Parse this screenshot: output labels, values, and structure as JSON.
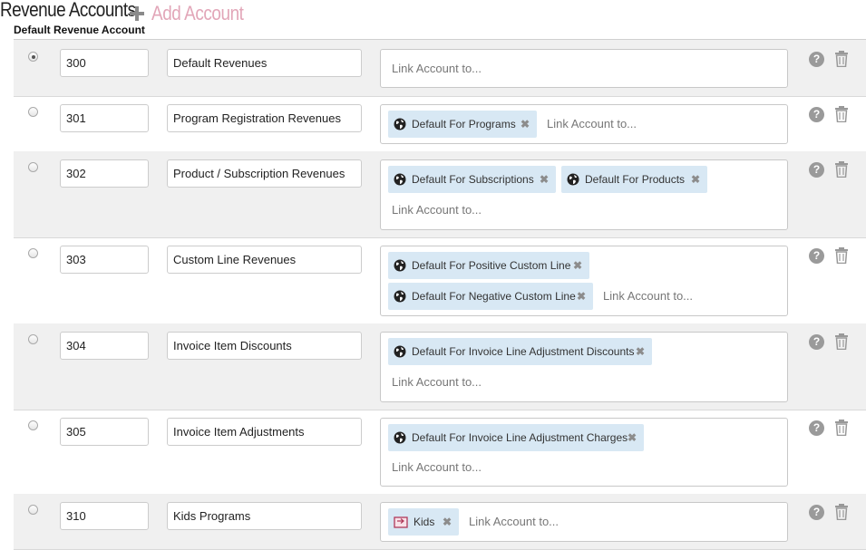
{
  "header": {
    "title": "Revenue Accounts",
    "add_label": "Add Account"
  },
  "column_header": "Default Revenue Account",
  "link_placeholder": "Link Account to...",
  "help_symbol": "?",
  "remove_symbol": "✖",
  "rows": [
    {
      "number": "300",
      "name": "Default Revenues",
      "is_default": true,
      "tags": []
    },
    {
      "number": "301",
      "name": "Program Registration Revenues",
      "is_default": false,
      "tags": [
        {
          "label": "Default For Programs",
          "icon": "globe-icon"
        }
      ]
    },
    {
      "number": "302",
      "name": "Product / Subscription Revenues",
      "is_default": false,
      "tags": [
        {
          "label": "Default For Subscriptions",
          "icon": "globe-icon"
        },
        {
          "label": "Default For Products",
          "icon": "globe-icon"
        }
      ]
    },
    {
      "number": "303",
      "name": "Custom Line Revenues",
      "is_default": false,
      "tags": [
        {
          "label": "Default For Positive Custom Line",
          "icon": "globe-icon"
        },
        {
          "label": "Default For Negative Custom Line",
          "icon": "globe-icon"
        }
      ]
    },
    {
      "number": "304",
      "name": "Invoice Item Discounts",
      "is_default": false,
      "tags": [
        {
          "label": "Default For Invoice Line Adjustment Discounts",
          "icon": "globe-icon"
        }
      ]
    },
    {
      "number": "305",
      "name": "Invoice Item Adjustments",
      "is_default": false,
      "tags": [
        {
          "label": "Default For Invoice Line Adjustment Charges",
          "icon": "globe-icon"
        }
      ]
    },
    {
      "number": "310",
      "name": "Kids Programs",
      "is_default": false,
      "tags": [
        {
          "label": "Kids",
          "icon": "program-icon"
        }
      ]
    }
  ]
}
